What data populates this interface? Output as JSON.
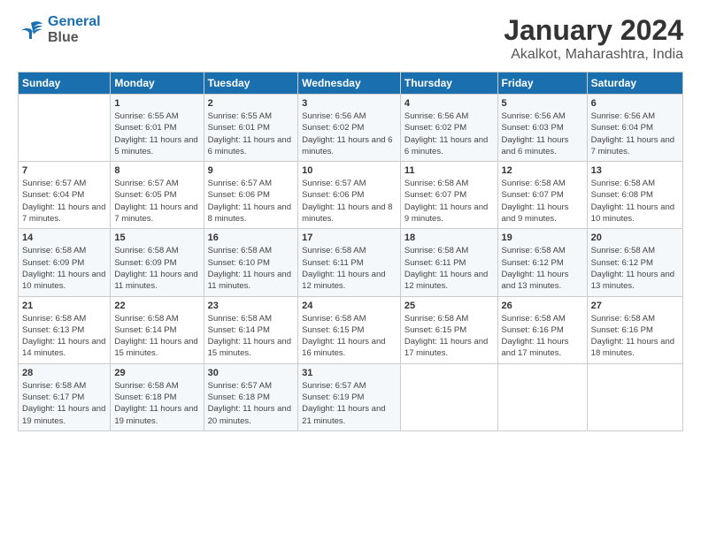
{
  "header": {
    "logo_line1": "General",
    "logo_line2": "Blue",
    "title": "January 2024",
    "subtitle": "Akalkot, Maharashtra, India"
  },
  "columns": [
    "Sunday",
    "Monday",
    "Tuesday",
    "Wednesday",
    "Thursday",
    "Friday",
    "Saturday"
  ],
  "weeks": [
    [
      {
        "day": "",
        "info": ""
      },
      {
        "day": "1",
        "info": "Sunrise: 6:55 AM\nSunset: 6:01 PM\nDaylight: 11 hours and 5 minutes."
      },
      {
        "day": "2",
        "info": "Sunrise: 6:55 AM\nSunset: 6:01 PM\nDaylight: 11 hours and 6 minutes."
      },
      {
        "day": "3",
        "info": "Sunrise: 6:56 AM\nSunset: 6:02 PM\nDaylight: 11 hours and 6 minutes."
      },
      {
        "day": "4",
        "info": "Sunrise: 6:56 AM\nSunset: 6:02 PM\nDaylight: 11 hours and 6 minutes."
      },
      {
        "day": "5",
        "info": "Sunrise: 6:56 AM\nSunset: 6:03 PM\nDaylight: 11 hours and 6 minutes."
      },
      {
        "day": "6",
        "info": "Sunrise: 6:56 AM\nSunset: 6:04 PM\nDaylight: 11 hours and 7 minutes."
      }
    ],
    [
      {
        "day": "7",
        "info": "Sunrise: 6:57 AM\nSunset: 6:04 PM\nDaylight: 11 hours and 7 minutes."
      },
      {
        "day": "8",
        "info": "Sunrise: 6:57 AM\nSunset: 6:05 PM\nDaylight: 11 hours and 7 minutes."
      },
      {
        "day": "9",
        "info": "Sunrise: 6:57 AM\nSunset: 6:06 PM\nDaylight: 11 hours and 8 minutes."
      },
      {
        "day": "10",
        "info": "Sunrise: 6:57 AM\nSunset: 6:06 PM\nDaylight: 11 hours and 8 minutes."
      },
      {
        "day": "11",
        "info": "Sunrise: 6:58 AM\nSunset: 6:07 PM\nDaylight: 11 hours and 9 minutes."
      },
      {
        "day": "12",
        "info": "Sunrise: 6:58 AM\nSunset: 6:07 PM\nDaylight: 11 hours and 9 minutes."
      },
      {
        "day": "13",
        "info": "Sunrise: 6:58 AM\nSunset: 6:08 PM\nDaylight: 11 hours and 10 minutes."
      }
    ],
    [
      {
        "day": "14",
        "info": "Sunrise: 6:58 AM\nSunset: 6:09 PM\nDaylight: 11 hours and 10 minutes."
      },
      {
        "day": "15",
        "info": "Sunrise: 6:58 AM\nSunset: 6:09 PM\nDaylight: 11 hours and 11 minutes."
      },
      {
        "day": "16",
        "info": "Sunrise: 6:58 AM\nSunset: 6:10 PM\nDaylight: 11 hours and 11 minutes."
      },
      {
        "day": "17",
        "info": "Sunrise: 6:58 AM\nSunset: 6:11 PM\nDaylight: 11 hours and 12 minutes."
      },
      {
        "day": "18",
        "info": "Sunrise: 6:58 AM\nSunset: 6:11 PM\nDaylight: 11 hours and 12 minutes."
      },
      {
        "day": "19",
        "info": "Sunrise: 6:58 AM\nSunset: 6:12 PM\nDaylight: 11 hours and 13 minutes."
      },
      {
        "day": "20",
        "info": "Sunrise: 6:58 AM\nSunset: 6:12 PM\nDaylight: 11 hours and 13 minutes."
      }
    ],
    [
      {
        "day": "21",
        "info": "Sunrise: 6:58 AM\nSunset: 6:13 PM\nDaylight: 11 hours and 14 minutes."
      },
      {
        "day": "22",
        "info": "Sunrise: 6:58 AM\nSunset: 6:14 PM\nDaylight: 11 hours and 15 minutes."
      },
      {
        "day": "23",
        "info": "Sunrise: 6:58 AM\nSunset: 6:14 PM\nDaylight: 11 hours and 15 minutes."
      },
      {
        "day": "24",
        "info": "Sunrise: 6:58 AM\nSunset: 6:15 PM\nDaylight: 11 hours and 16 minutes."
      },
      {
        "day": "25",
        "info": "Sunrise: 6:58 AM\nSunset: 6:15 PM\nDaylight: 11 hours and 17 minutes."
      },
      {
        "day": "26",
        "info": "Sunrise: 6:58 AM\nSunset: 6:16 PM\nDaylight: 11 hours and 17 minutes."
      },
      {
        "day": "27",
        "info": "Sunrise: 6:58 AM\nSunset: 6:16 PM\nDaylight: 11 hours and 18 minutes."
      }
    ],
    [
      {
        "day": "28",
        "info": "Sunrise: 6:58 AM\nSunset: 6:17 PM\nDaylight: 11 hours and 19 minutes."
      },
      {
        "day": "29",
        "info": "Sunrise: 6:58 AM\nSunset: 6:18 PM\nDaylight: 11 hours and 19 minutes."
      },
      {
        "day": "30",
        "info": "Sunrise: 6:57 AM\nSunset: 6:18 PM\nDaylight: 11 hours and 20 minutes."
      },
      {
        "day": "31",
        "info": "Sunrise: 6:57 AM\nSunset: 6:19 PM\nDaylight: 11 hours and 21 minutes."
      },
      {
        "day": "",
        "info": ""
      },
      {
        "day": "",
        "info": ""
      },
      {
        "day": "",
        "info": ""
      }
    ]
  ]
}
